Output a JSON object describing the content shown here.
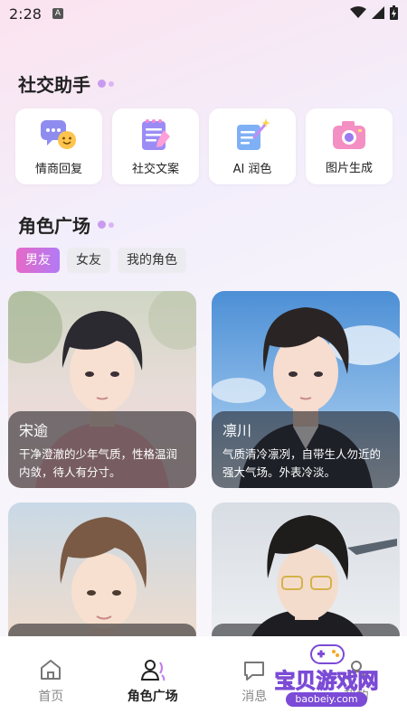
{
  "status": {
    "time": "2:28",
    "a_badge": "A"
  },
  "social": {
    "title": "社交助手",
    "tools": [
      {
        "label": "情商回复",
        "icon": "chat-bubble-smile-icon"
      },
      {
        "label": "社交文案",
        "icon": "notepad-pen-icon"
      },
      {
        "label": "AI 润色",
        "icon": "document-magic-wand-icon"
      },
      {
        "label": "图片生成",
        "icon": "camera-icon"
      }
    ]
  },
  "roles": {
    "title": "角色广场",
    "chips": [
      "男友",
      "女友",
      "我的角色"
    ],
    "active_chip": "男友",
    "cards": [
      {
        "name": "宋逾",
        "desc": "干净澄澈的少年气质，性格温润内敛，待人有分寸。"
      },
      {
        "name": "凛川",
        "desc": "气质清冷凛冽，自带生人勿近的强大气场。外表冷淡。"
      },
      {
        "name": "",
        "desc": ""
      },
      {
        "name": "",
        "desc": ""
      }
    ]
  },
  "tabbar": {
    "items": [
      {
        "label": "首页",
        "icon": "home-icon"
      },
      {
        "label": "角色广场",
        "icon": "user-square-icon"
      },
      {
        "label": "消息",
        "icon": "message-icon"
      },
      {
        "label": "我的",
        "icon": "profile-icon"
      }
    ],
    "active": "角色广场"
  },
  "watermark": {
    "title": "宝贝游戏网",
    "url": "baobeiy.com"
  },
  "colors": {
    "accent_start": "#e569c7",
    "accent_end": "#b27af5"
  }
}
